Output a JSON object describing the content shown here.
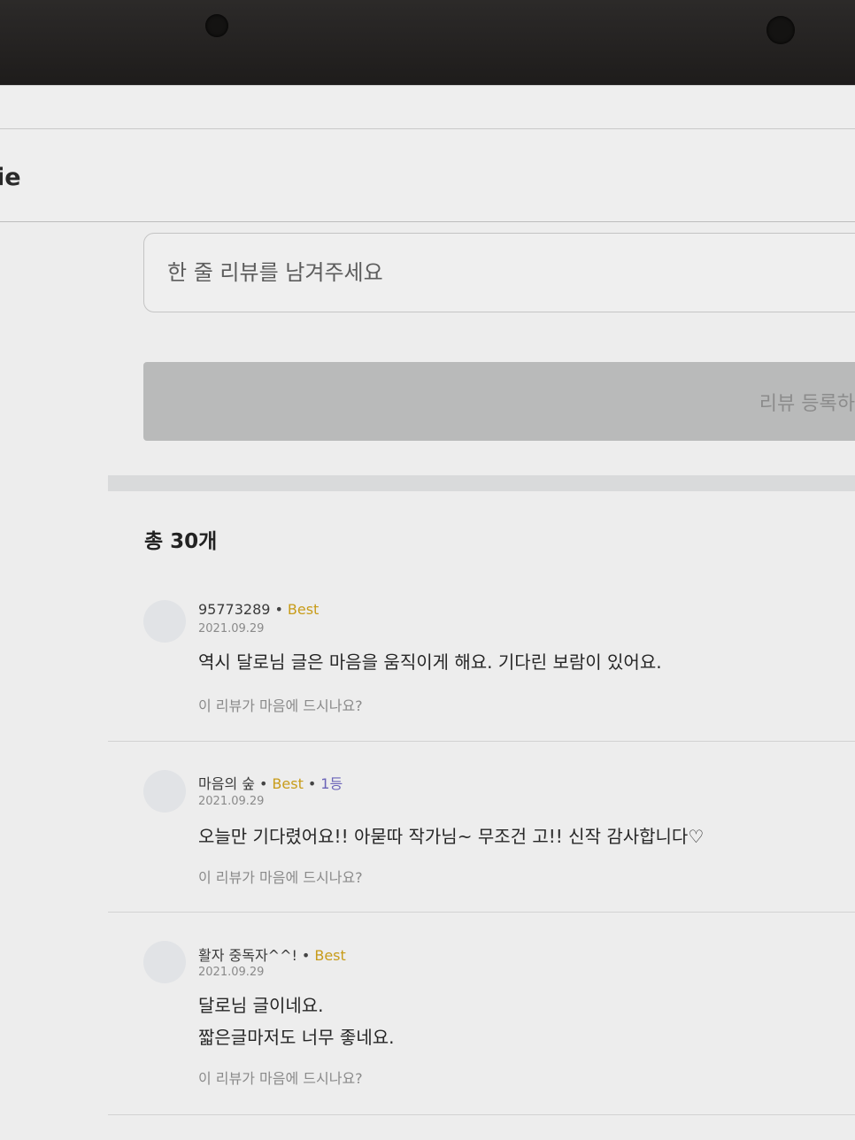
{
  "header": {
    "title": "ie"
  },
  "review_form": {
    "placeholder": "한 줄 리뷰를 남겨주세요",
    "submit_label": "리뷰 등록하"
  },
  "summary": {
    "total": "총 30개"
  },
  "reviews": [
    {
      "author": "95773289",
      "badge": "Best",
      "rank": "",
      "date": "2021.09.29",
      "lines": [
        "역시 달로님 글은 마음을 움직이게 해요. 기다린 보람이 있어요."
      ],
      "like_prompt": "이 리뷰가 마음에 드시나요?"
    },
    {
      "author": "마음의 숲",
      "badge": "Best",
      "rank": "1등",
      "date": "2021.09.29",
      "lines": [
        "오늘만 기다렸어요!! 아묻따 작가님~ 무조건 고!! 신작 감사합니다♡"
      ],
      "like_prompt": "이 리뷰가 마음에 드시나요?"
    },
    {
      "author": "활자 중독자^^!",
      "badge": "Best",
      "rank": "",
      "date": "2021.09.29",
      "lines": [
        "달로님 글이네요.",
        "짧은글마저도 너무 좋네요."
      ],
      "like_prompt": "이 리뷰가 마음에 드시나요?"
    }
  ]
}
